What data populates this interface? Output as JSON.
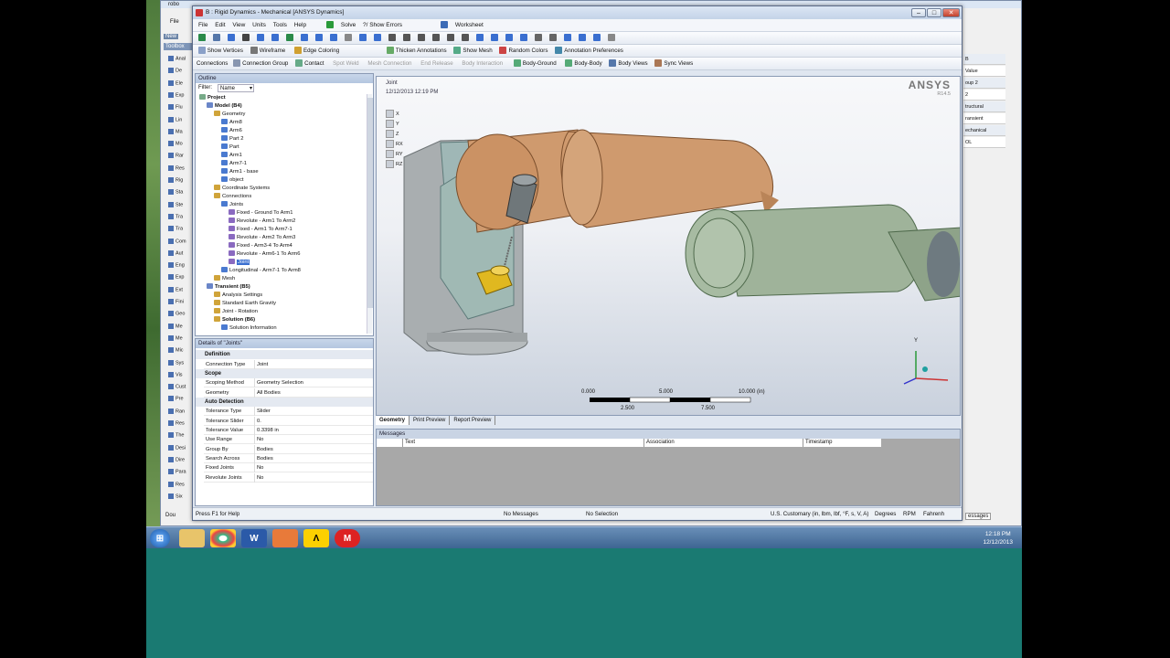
{
  "window": {
    "title": "B : Rigid Dynamics - Mechanical [ANSYS Dynamics]",
    "min": "–",
    "max": "□",
    "close": "✕"
  },
  "bg_window": {
    "title": "robo",
    "file_menu": "File",
    "toolbox": "Toolbox",
    "new_label": "New",
    "value_header": "Value",
    "cells": [
      "B",
      "Value",
      "oup 2",
      "2",
      "tructural",
      "ransient",
      "echanical",
      "OL"
    ],
    "left_items": [
      "Anal",
      "De",
      "Ele",
      "Exp",
      "Flu",
      "Lin",
      "Ma",
      "Mo",
      "Rar",
      "Res",
      "Rig",
      "Sta",
      "Ste",
      "Tra",
      "Tra",
      "Com",
      "Aut",
      "Eng",
      "Exp",
      "Ext",
      "Fini",
      "Geo",
      "Me",
      "Me",
      "Mic",
      "Sys",
      "Vis",
      "Cust",
      "Pre",
      "Ran",
      "Res",
      "The",
      "Desi",
      "Dire",
      "Para",
      "Res",
      "Six"
    ],
    "messages_label": "essages",
    "bottom_left": "Dou"
  },
  "menu": [
    "File",
    "Edit",
    "View",
    "Units",
    "Tools",
    "Help"
  ],
  "toolbar1": {
    "solve": "Solve",
    "show_errors": "?/ Show Errors",
    "worksheet": "Worksheet"
  },
  "toolbar3": [
    "Show Vertices",
    "Wireframe",
    "Edge Coloring",
    "Thicken Annotations",
    "Show Mesh",
    "Random Colors",
    "Annotation Preferences"
  ],
  "toolbar4": [
    "Connections",
    "Connection Group",
    "Contact",
    "Spot Weld",
    "Mesh Connection",
    "End Release",
    "Body Interaction",
    "Body-Ground",
    "Body-Body",
    "Body Views",
    "Sync Views"
  ],
  "outline": {
    "title": "Outline",
    "filter_label": "Filter:",
    "filter_value": "Name",
    "tree": [
      {
        "label": "Project",
        "level": 0,
        "bold": true
      },
      {
        "label": "Model (B4)",
        "level": 1,
        "bold": true
      },
      {
        "label": "Geometry",
        "level": 2
      },
      {
        "label": "Arm8",
        "level": 3
      },
      {
        "label": "Arm6",
        "level": 3
      },
      {
        "label": "Part 2",
        "level": 3
      },
      {
        "label": "Part",
        "level": 3
      },
      {
        "label": "Arm1",
        "level": 3
      },
      {
        "label": "Arm7-1",
        "level": 3
      },
      {
        "label": "Arm1 - base",
        "level": 3
      },
      {
        "label": "object",
        "level": 3
      },
      {
        "label": "Coordinate Systems",
        "level": 2
      },
      {
        "label": "Connections",
        "level": 2
      },
      {
        "label": "Joints",
        "level": 3
      },
      {
        "label": "Fixed - Ground To Arm1",
        "level": 4
      },
      {
        "label": "Revolute - Arm1 To Arm2",
        "level": 4
      },
      {
        "label": "Fixed - Arm1 To Arm7-1",
        "level": 4
      },
      {
        "label": "Revolute - Arm2 To Arm3",
        "level": 4
      },
      {
        "label": "Fixed - Arm3-4 To Arm4",
        "level": 4
      },
      {
        "label": "Revolute - Arm6-1 To Arm6",
        "level": 4
      },
      {
        "label": "Joint",
        "level": 4,
        "selected": true
      },
      {
        "label": "Longitudinal - Arm7-1 To Arm8",
        "level": 3
      },
      {
        "label": "Mesh",
        "level": 2
      },
      {
        "label": "Transient (B5)",
        "level": 1,
        "bold": true
      },
      {
        "label": "Analysis Settings",
        "level": 2
      },
      {
        "label": "Standard Earth Gravity",
        "level": 2
      },
      {
        "label": "Joint - Rotation",
        "level": 2
      },
      {
        "label": "Solution (B6)",
        "level": 2,
        "bold": true
      },
      {
        "label": "Solution Information",
        "level": 3
      }
    ]
  },
  "details": {
    "title": "Details of \"Joints\"",
    "groups": [
      {
        "name": "Definition",
        "rows": [
          [
            "Connection Type",
            "Joint"
          ]
        ]
      },
      {
        "name": "Scope",
        "rows": [
          [
            "Scoping Method",
            "Geometry Selection"
          ],
          [
            "Geometry",
            "All Bodies"
          ]
        ]
      },
      {
        "name": "Auto Detection",
        "rows": [
          [
            "Tolerance Type",
            "Slider"
          ],
          [
            "Tolerance Slider",
            "0."
          ],
          [
            "Tolerance Value",
            "0.3398 in"
          ],
          [
            "Use Range",
            "No"
          ],
          [
            "Group By",
            "Bodies"
          ],
          [
            "Search Across",
            "Bodies"
          ],
          [
            "Fixed Joints",
            "No"
          ],
          [
            "Revolute Joints",
            "No"
          ]
        ]
      }
    ]
  },
  "viewport": {
    "label": "Joint",
    "timestamp": "12/12/2013 12:19 PM",
    "brand": "ANSYS",
    "version": "R14.5",
    "dof": [
      "X",
      "Y",
      "Z",
      "RX",
      "RY",
      "RZ"
    ],
    "scale_top": [
      "0.000",
      "5.000",
      "10.000 (in)"
    ],
    "scale_bottom": [
      "2.500",
      "7.500"
    ],
    "triad_y": "Y"
  },
  "tabs": [
    "Geometry",
    "Print Preview",
    "Report Preview"
  ],
  "messages": {
    "title": "Messages",
    "columns": [
      "Text",
      "Association",
      "Timestamp"
    ]
  },
  "status": {
    "help": "Press F1 for Help",
    "messages": "No Messages",
    "selection": "No Selection",
    "units": "U.S. Customary (in, lbm, lbf, °F, s, V, A)",
    "angle": "Degrees",
    "rpm": "RPM",
    "temp": "Fahrenh"
  },
  "taskbar": {
    "time": "12:18 PM",
    "date": "12/12/2013"
  },
  "colors": {
    "arm_orange": "#cf9a6e",
    "arm_green": "#9fb39a",
    "base_gray": "#a9aeb0",
    "select_blue": "#3a6fd0"
  }
}
